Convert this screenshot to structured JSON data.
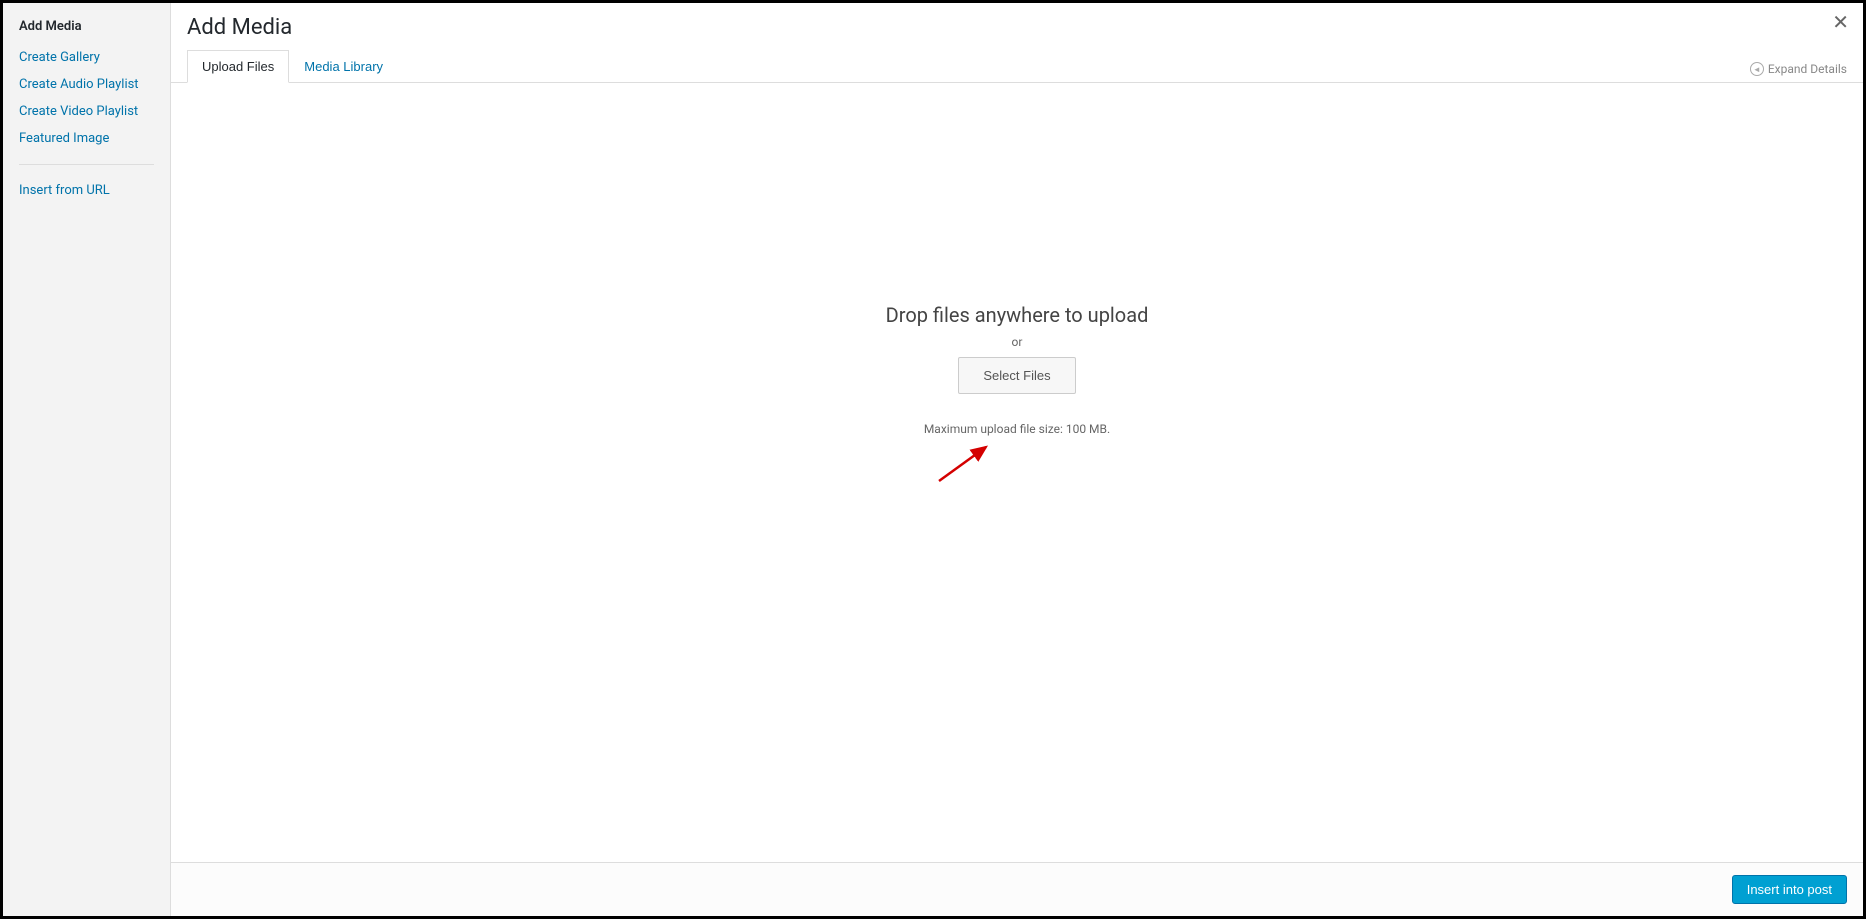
{
  "sidebar": {
    "title": "Add Media",
    "items": [
      {
        "label": "Create Gallery"
      },
      {
        "label": "Create Audio Playlist"
      },
      {
        "label": "Create Video Playlist"
      },
      {
        "label": "Featured Image"
      }
    ],
    "insert_url": "Insert from URL"
  },
  "header": {
    "title": "Add Media",
    "expand_details": "Expand Details"
  },
  "tabs": {
    "upload_files": "Upload Files",
    "media_library": "Media Library"
  },
  "upload_area": {
    "drop_text": "Drop files anywhere to upload",
    "or_text": "or",
    "select_button": "Select Files",
    "max_upload": "Maximum upload file size: 100 MB."
  },
  "footer": {
    "insert_button": "Insert into post"
  }
}
